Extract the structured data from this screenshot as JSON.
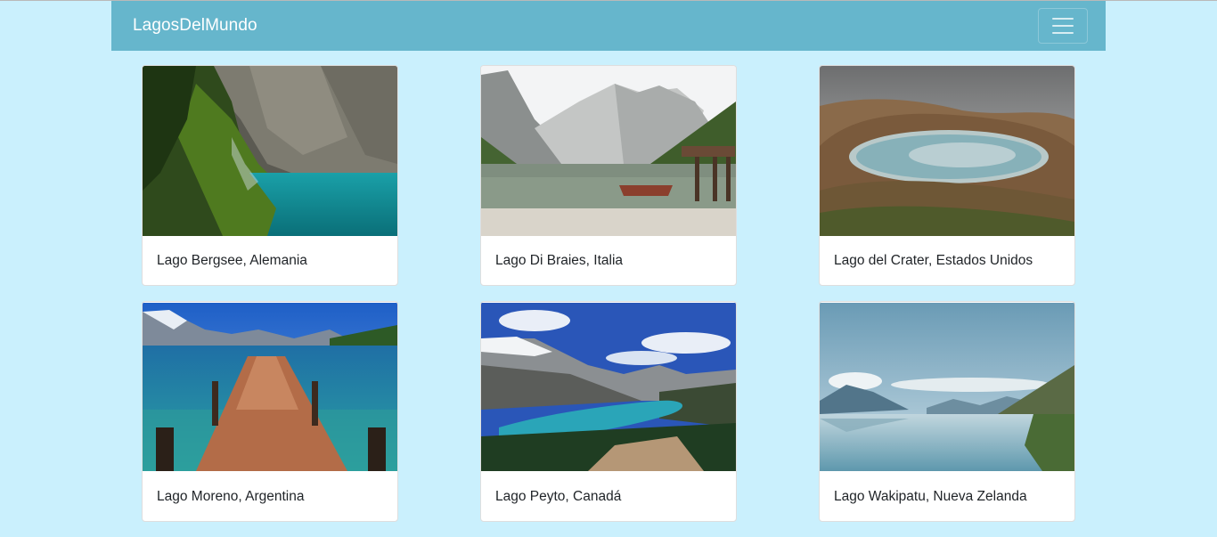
{
  "navbar": {
    "brand": "LagosDelMundo",
    "toggler_icon": "hamburger-menu-icon",
    "background": "#66b6cc"
  },
  "page": {
    "background": "#caf0fd"
  },
  "lakes": [
    {
      "caption": "Lago Bergsee, Alemania"
    },
    {
      "caption": "Lago Di Braies, Italia"
    },
    {
      "caption": "Lago del Crater, Estados Unidos"
    },
    {
      "caption": "Lago Moreno, Argentina"
    },
    {
      "caption": "Lago Peyto, Canadá"
    },
    {
      "caption": "Lago Wakipatu, Nueva Zelanda"
    }
  ]
}
